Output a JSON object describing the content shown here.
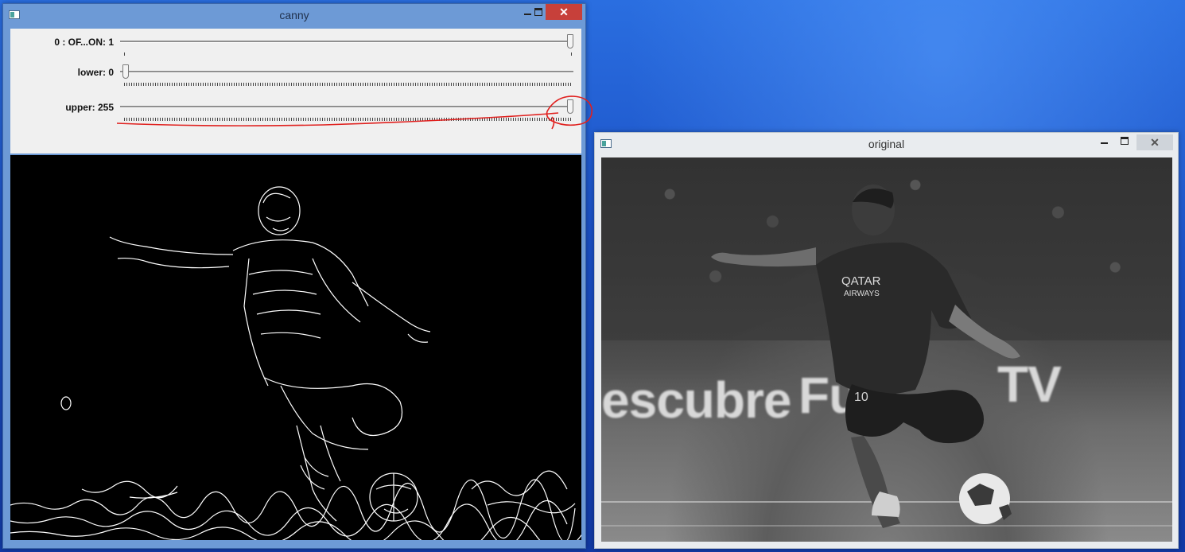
{
  "windows": {
    "canny": {
      "title": "canny",
      "trackbars": [
        {
          "label": "0 : OF...ON: 1",
          "value": 1,
          "max": 1
        },
        {
          "label": "lower: 0",
          "value": 0,
          "max": 255
        },
        {
          "label": "upper: 255",
          "value": 255,
          "max": 255
        }
      ]
    },
    "original": {
      "title": "original",
      "banner": {
        "left_text": "escubre",
        "mid_text": "Fu",
        "right_text": "TV"
      },
      "jersey": {
        "line1": "QATAR",
        "line2": "AIRWAYS",
        "number": "10"
      }
    }
  },
  "colors": {
    "annotation": "#e0201e",
    "active_titlebar": "#6d9ad6",
    "close_button": "#c7403a"
  },
  "icons": [
    "app-icon",
    "minimize-icon",
    "maximize-icon",
    "close-icon"
  ]
}
